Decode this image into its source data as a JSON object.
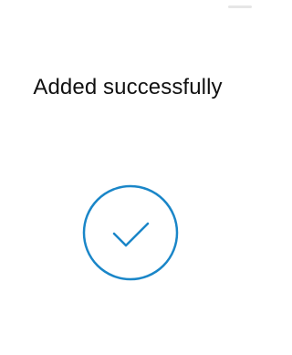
{
  "screen": {
    "title": "Added successfully",
    "icon": "checkmark-circle-icon"
  },
  "colors": {
    "background": "#ffffff",
    "text": "#111111",
    "accent": "#1a86c8"
  }
}
